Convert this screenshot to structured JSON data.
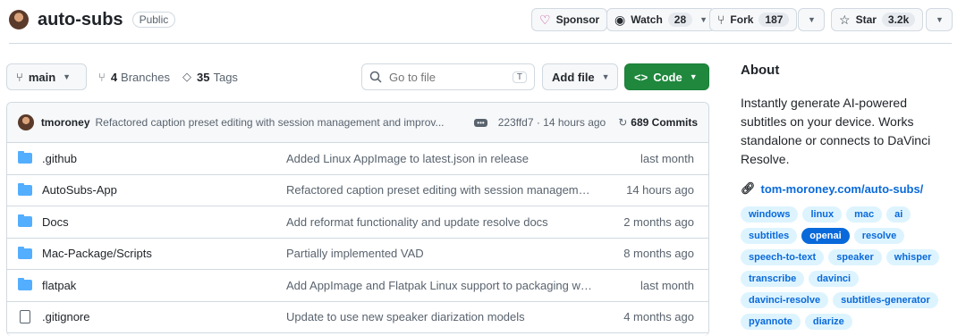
{
  "repo": {
    "name": "auto-subs",
    "visibility": "Public"
  },
  "header_buttons": {
    "sponsor": "Sponsor",
    "watch": {
      "label": "Watch",
      "count": "28"
    },
    "fork": {
      "label": "Fork",
      "count": "187"
    },
    "star": {
      "label": "Star",
      "count": "3.2k"
    }
  },
  "toolbar": {
    "branch": "main",
    "branches_count": "4",
    "branches_label": "Branches",
    "tags_count": "35",
    "tags_label": "Tags",
    "search_placeholder": "Go to file",
    "search_shortcut": "T",
    "add_file": "Add file",
    "code": "Code"
  },
  "latest_commit": {
    "author": "tmoroney",
    "message": "Refactored caption preset editing with session management and improv...",
    "sha_time": "223ffd7 · 14 hours ago",
    "commits": "689 Commits"
  },
  "files": [
    {
      "type": "folder",
      "name": ".github",
      "message": "Added Linux AppImage to latest.json in release",
      "time": "last month"
    },
    {
      "type": "folder",
      "name": "AutoSubs-App",
      "message": "Refactored caption preset editing with session manageme...",
      "time": "14 hours ago"
    },
    {
      "type": "folder",
      "name": "Docs",
      "message": "Add reformat functionality and update resolve docs",
      "time": "2 months ago"
    },
    {
      "type": "folder",
      "name": "Mac-Package/Scripts",
      "message": "Partially implemented VAD",
      "time": "8 months ago"
    },
    {
      "type": "folder",
      "name": "flatpak",
      "message": "Add AppImage and Flatpak Linux support to packaging wo...",
      "time": "last month"
    },
    {
      "type": "file",
      "name": ".gitignore",
      "message": "Update to use new speaker diarization models",
      "time": "4 months ago"
    }
  ],
  "about": {
    "heading": "About",
    "description": "Instantly generate AI-powered subtitles on your device. Works standalone or connects to DaVinci Resolve.",
    "website": "tom-moroney.com/auto-subs/",
    "topics": [
      "windows",
      "linux",
      "mac",
      "ai",
      "subtitles",
      "openai",
      "resolve",
      "speech-to-text",
      "speaker",
      "whisper",
      "transcribe",
      "davinci",
      "davinci-resolve",
      "subtitles-generator",
      "pyannote",
      "diarize"
    ],
    "active_topic": "openai"
  },
  "colors": {
    "accent": "#0969da",
    "code_button": "#1f883d",
    "folder": "#54aeff",
    "topic_bg": "#ddf4ff"
  }
}
